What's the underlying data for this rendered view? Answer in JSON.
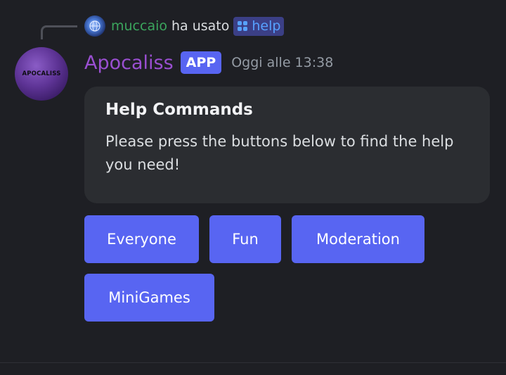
{
  "reply": {
    "user": "muccaio",
    "action_text": "ha usato",
    "command": "help"
  },
  "message": {
    "author": "Apocaliss",
    "avatar_text": "APOCALISS",
    "badge": "APP",
    "timestamp": "Oggi alle 13:38"
  },
  "embed": {
    "title": "Help Commands",
    "description": "Please press the buttons below to find the help you need!"
  },
  "buttons": [
    {
      "label": "Everyone"
    },
    {
      "label": "Fun"
    },
    {
      "label": "Moderation"
    },
    {
      "label": "MiniGames"
    }
  ],
  "colors": {
    "background": "#1e1f24",
    "embed_background": "#2b2d31",
    "button": "#5865f2",
    "author_name": "#9a4fd1",
    "reply_user": "#3ba55d",
    "command_chip": "#3b3f86",
    "command_text": "#57a1ff"
  },
  "icons": {
    "reply_avatar": "blue-globe-avatar",
    "command": "slash-command-grid-icon",
    "reply_connector": "reply-spine"
  }
}
